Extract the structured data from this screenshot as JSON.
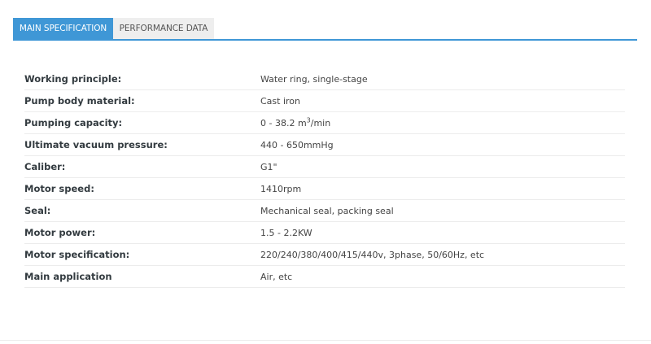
{
  "tabs": [
    {
      "label": "MAIN SPECIFICATION",
      "active": true
    },
    {
      "label": "PERFORMANCE DATA",
      "active": false
    }
  ],
  "accent_color": "#3f97d6",
  "specs": [
    {
      "label": "Working principle:",
      "value": "Water ring, single-stage"
    },
    {
      "label": "Pump body material:",
      "value": "Cast iron"
    },
    {
      "label": "Pumping capacity:",
      "value_prefix": "0 - 38.2 m",
      "value_sup": "3",
      "value_suffix": "/min"
    },
    {
      "label": "Ultimate vacuum pressure:",
      "value": "440 - 650mmHg"
    },
    {
      "label": "Caliber:",
      "value": "G1\""
    },
    {
      "label": "Motor speed:",
      "value": "1410rpm"
    },
    {
      "label": "Seal:",
      "value": "Mechanical seal, packing seal"
    },
    {
      "label": "Motor power:",
      "value": "1.5 - 2.2KW"
    },
    {
      "label": "Motor specification:",
      "value": "220/240/380/400/415/440v, 3phase, 50/60Hz, etc"
    },
    {
      "label": "Main application",
      "value": "Air, etc"
    }
  ]
}
